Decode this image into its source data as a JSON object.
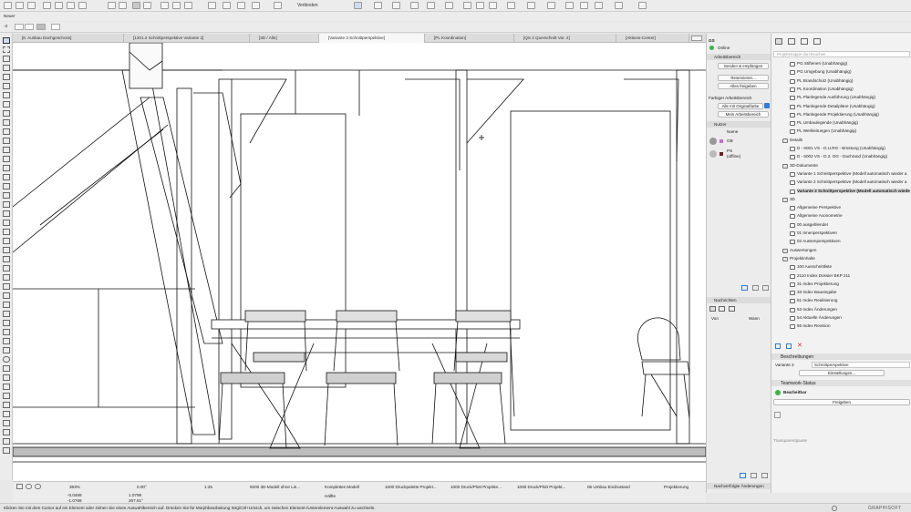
{
  "toolbar": {
    "connect_label": "Verbinden"
  },
  "menu": {
    "item": "Neuer"
  },
  "subbar": {
    "floor": "-2"
  },
  "tabs": [
    {
      "label": "[8. Ausbau Dachgeschoss]"
    },
    {
      "label": "[1201.2 Schnittperspektive Variante 2]"
    },
    {
      "label": "[3D / Alle]"
    },
    {
      "label": "[Variante 3 Schnittperspektive]"
    },
    {
      "label": "[PL Koordination]"
    },
    {
      "label": "[QS 2 Querschnitt Var. 2]"
    },
    {
      "label": "[Aktions-Center]"
    }
  ],
  "nav": {
    "gs": "GS",
    "online": "Online",
    "workspace_header": "Arbeitsbereich",
    "send_receive": "Senden & empfangen",
    "reserve": "Reservieren...",
    "release_all": "Alles freigeben",
    "color_header": "Farbiger Arbeitsbereich",
    "original_color": "Alle mit Originalfarbe",
    "my_workspace": "Mein Arbeitsbereich",
    "users_header": "Nutzer",
    "users": [
      {
        "name": "Name"
      },
      {
        "name": "GB"
      },
      {
        "name": "PS"
      },
      {
        "name": "(offline)"
      }
    ],
    "messages_header": "Nachrichten",
    "from_label": "Von",
    "when_label": "Wann"
  },
  "tree": {
    "search_placeholder": "Projektmappe durchsuchen",
    "items": [
      {
        "label": "PG Stifteneri (Unabhängig)"
      },
      {
        "label": "PG Umgebung (Unabhängig)"
      },
      {
        "label": "PL Brandschutz (Unabhängig)"
      },
      {
        "label": "PL Koordination (Unabhängig)"
      },
      {
        "label": "PL Planlegende Ausführung (Unabhängig)"
      },
      {
        "label": "PL Planlegende Detailpläne (Unabhängig)"
      },
      {
        "label": "PL Planlegende Projektierung (Unabhängig)"
      },
      {
        "label": "PL Umbaulegende (Unabhängig)"
      },
      {
        "label": "PL Werkleitungen (Unabhängig)"
      },
      {
        "label": "Details"
      },
      {
        "label": "D - 6001 VS - D.U.RG - Brüstung (Unabhängig)"
      },
      {
        "label": "D - 6002 VS - D.2. OG - Dachrand (Unabhängig)"
      },
      {
        "label": "3D-Dokumente"
      },
      {
        "label": "Variante 1 Schnittperspektive (Modell automatisch wieder a"
      },
      {
        "label": "Variante 2 Schnittperspektive (Modell automatisch wieder a"
      },
      {
        "label": "Variante 3 Schnittperspektive (Modell automatisch wiede"
      },
      {
        "label": "3D"
      },
      {
        "label": "Allgemeine Perspektive"
      },
      {
        "label": "Allgemeine Axonometrie"
      },
      {
        "label": "00 ausgeblendet"
      },
      {
        "label": "01 Innenperspektiven"
      },
      {
        "label": "02 Aussenperspektiven"
      },
      {
        "label": "Auswertungen"
      },
      {
        "label": "Projektinhalte"
      },
      {
        "label": "100 Ausschnittliste"
      },
      {
        "label": "2110 Index Dossier BKP 211"
      },
      {
        "label": "31 Index Projektierung"
      },
      {
        "label": "33 Index Baueingabe"
      },
      {
        "label": "51 Index Realisierung"
      },
      {
        "label": "53 Index Änderungen"
      },
      {
        "label": "54 Aktuelle Änderungen"
      },
      {
        "label": "55 Index Revision"
      }
    ],
    "descriptions_header": "Beschreibungen",
    "desc_field": "Variante 3",
    "desc_value": "Schnittperspektive",
    "settings_button": "Einstellungen...",
    "teamwork_header": "Teamwork-Status",
    "editable": "Bearbeitbar",
    "released": "Freigeben",
    "transparency": "Transparentpause"
  },
  "bottom": {
    "zoom": "363%",
    "angle": "0.00°",
    "scale": "1:25",
    "model": "9200 3D-Modell ohne Lin...",
    "full_model": "Komplettes Modell",
    "print1": "1000 Druckpalette Projekt...",
    "print2": "1000 Druck/Plott Projekte...",
    "print3": "1000 Druck/Plott Projekt...",
    "umbau": "05 Umbau Endzustand",
    "projektierung": "Projektierung",
    "coord_dx": "-0.0469",
    "coord_dy": "-1.0769",
    "coord_r": "1.0799",
    "coord_a": "267.51°",
    "half": "Hälfte",
    "nachverfolgte": "Nachverfolgte Änderungen"
  },
  "status": {
    "hint": "Klicken Sie mit dem Cursor auf ein Element oder ziehen Sie einen Auswahlbereich auf. Drücken Sie für Morphbearbeitung Strg/Ctrl+Umsch, um zwischen Element-/Unterelement-Auswahl zu wechseln.",
    "brand": "GRAPHISOFT"
  },
  "colors": {
    "accent": "#2f7bd6",
    "online": "#3cb34a"
  }
}
